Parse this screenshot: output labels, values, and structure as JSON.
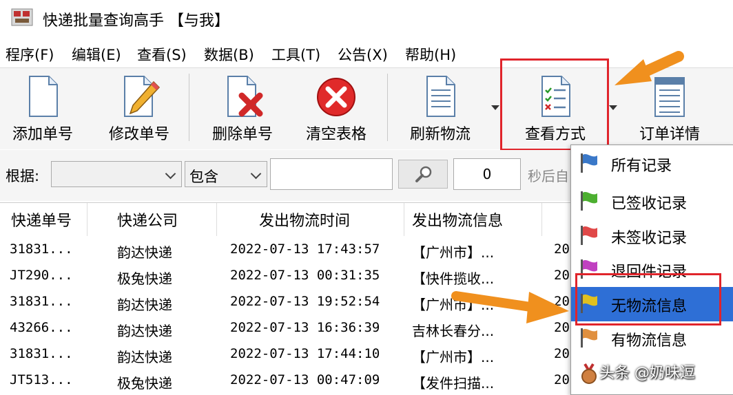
{
  "window": {
    "title": "快递批量查询高手 【与我】"
  },
  "menubar": [
    "程序(F)",
    "编辑(E)",
    "查看(S)",
    "数据(B)",
    "工具(T)",
    "公告(X)",
    "帮助(H)"
  ],
  "toolbar": {
    "add": "添加单号",
    "edit": "修改单号",
    "delete": "删除单号",
    "clear": "清空表格",
    "refresh": "刷新物流",
    "view_mode": "查看方式",
    "order_detail": "订单详情"
  },
  "filter": {
    "label": "根据:",
    "field_value": "",
    "match_value": "包含",
    "search_value": "",
    "seconds_value": "0",
    "seconds_label": "秒后自"
  },
  "table": {
    "headers": [
      "快递单号",
      "快递公司",
      "发出物流时间",
      "发出物流信息"
    ],
    "rows": [
      [
        "31831...",
        "韵达快递",
        "2022-07-13 17:43:57",
        "【广州市】...",
        "20"
      ],
      [
        "JT290...",
        "极兔快递",
        "2022-07-13 00:31:35",
        "【快件揽收...",
        "20"
      ],
      [
        "31831...",
        "韵达快递",
        "2022-07-13 19:52:54",
        "【广州市】...",
        "20"
      ],
      [
        "43266...",
        "韵达快递",
        "2022-07-13 16:36:39",
        "吉林长春分...",
        "20"
      ],
      [
        "31831...",
        "韵达快递",
        "2022-07-13 17:44:10",
        "【广州市】...",
        "20"
      ],
      [
        "JT513...",
        "极兔快递",
        "2022-07-13 00:47:09",
        "【发件扫描...",
        "20"
      ]
    ]
  },
  "view_menu": {
    "items": [
      {
        "label": "所有记录",
        "icon": "flag-blue-icon",
        "color": "#3a78c8"
      },
      {
        "label": "已签收记录",
        "icon": "flag-green-icon",
        "color": "#4caf30"
      },
      {
        "label": "未签收记录",
        "icon": "flag-red-icon",
        "color": "#e04848"
      },
      {
        "label": "退回件记录",
        "icon": "flag-purple-icon",
        "color": "#c040c0"
      },
      {
        "label": "无物流信息",
        "icon": "flag-yellow-icon",
        "color": "#e0c020",
        "highlighted": true
      },
      {
        "label": "有物流信息",
        "icon": "flag-orange-icon",
        "color": "#e09040"
      },
      {
        "label": "",
        "icon": "medal-icon",
        "color": "#d08040"
      }
    ]
  },
  "watermark": "头条 @奶味逗",
  "colors": {
    "highlight": "#2e6fd6",
    "annotation_red": "#e0242b",
    "arrow_orange": "#f0901e"
  }
}
